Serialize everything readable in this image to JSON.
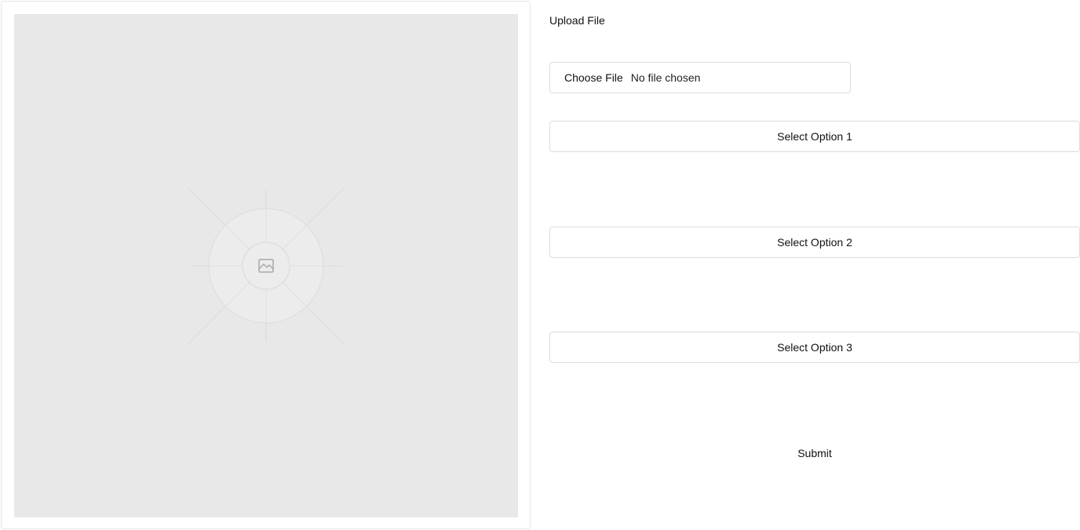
{
  "upload": {
    "label": "Upload File",
    "choose_label": "Choose File",
    "status": "No file chosen"
  },
  "options": {
    "option1": "Select Option 1",
    "option2": "Select Option 2",
    "option3": "Select Option 3"
  },
  "submit": {
    "label": "Submit"
  },
  "preview": {
    "icon": "image-placeholder-icon",
    "background": "#e8e8e8"
  }
}
